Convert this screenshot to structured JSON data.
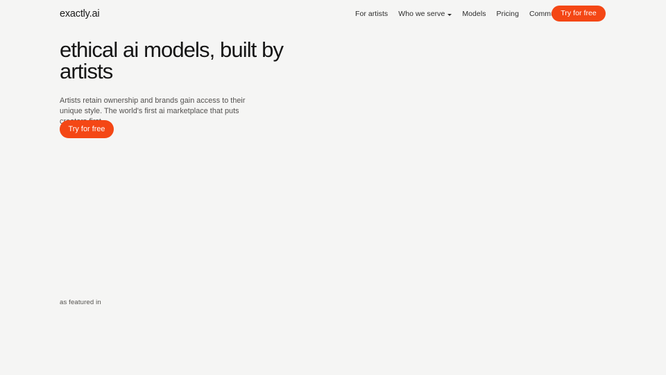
{
  "theme": {
    "background": "#f5f5f4",
    "accent": "#f44715",
    "text_primary": "#151515",
    "text_muted": "#52504e",
    "nav_text": "#2b2b2b",
    "on_accent": "#ffffff"
  },
  "header": {
    "logo": "exactly.ai",
    "nav": [
      {
        "label": "For artists",
        "has_dropdown": false
      },
      {
        "label": "Who we serve",
        "has_dropdown": true,
        "caret_icon": "chevron-down-icon"
      },
      {
        "label": "Models",
        "has_dropdown": false
      },
      {
        "label": "Pricing",
        "has_dropdown": false
      },
      {
        "label": "Community",
        "has_dropdown": true,
        "caret_icon": "chevron-down-icon"
      }
    ],
    "cta_label": "Try for free"
  },
  "hero": {
    "title_line_1": "ethical ai models, built",
    "title_line_2": "by artists",
    "title_full": "ethical ai models, built by artists",
    "subtitle": "Artists retain ownership and brands gain access to their unique style. The world's first ai marketplace that puts creators first.",
    "cta_label": "Try for free"
  },
  "featured": {
    "label": "as featured in",
    "logos": []
  }
}
